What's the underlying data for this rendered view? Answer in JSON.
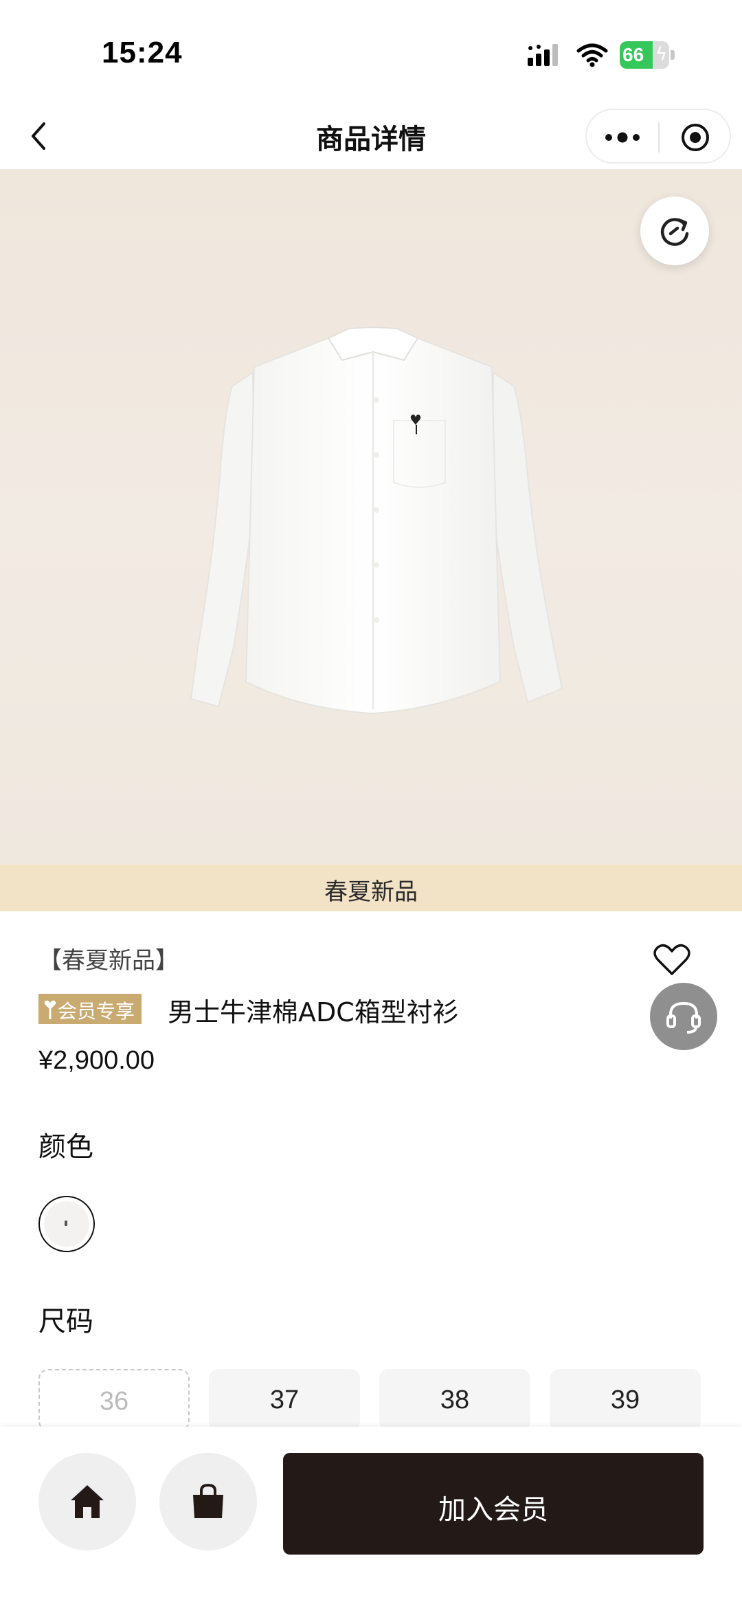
{
  "status_bar": {
    "time": "15:24",
    "battery": "66",
    "battery_level": 0.66
  },
  "nav": {
    "title": "商品详情"
  },
  "hero": {
    "banner": "春夏新品"
  },
  "product": {
    "tag": "【春夏新品】",
    "member_badge": "会员专享",
    "name": "男士牛津棉ADC箱型衬衫",
    "price": "¥2,900.00"
  },
  "color": {
    "label": "颜色"
  },
  "size": {
    "label": "尺码",
    "options": [
      {
        "label": "36",
        "available": false
      },
      {
        "label": "37",
        "available": true
      },
      {
        "label": "38",
        "available": true
      },
      {
        "label": "39",
        "available": true
      }
    ]
  },
  "bottom": {
    "join_label": "加入会员"
  },
  "colors": {
    "member_gold": "#c9aa71",
    "banner": "#f3e3c6",
    "cta": "#231a18",
    "battery_green": "#34c759"
  }
}
